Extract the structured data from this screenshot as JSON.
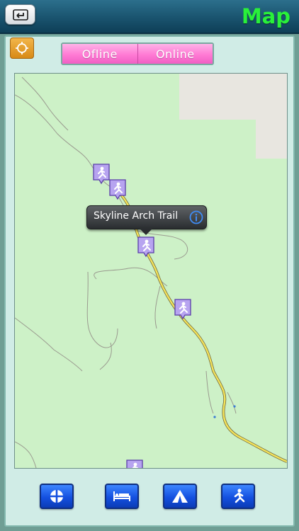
{
  "header": {
    "title": "Map"
  },
  "segments": {
    "offline_label": "Ofline",
    "online_label": "Online"
  },
  "map": {
    "callout": {
      "title": "Skyline Arch Trail"
    },
    "pins": [
      "hiking-trail",
      "hiking-trail",
      "hiking-trail",
      "hiking-trail",
      "hiking-trail"
    ]
  },
  "toolbar": {
    "buttons": [
      "crosshair-icon",
      "bed-icon",
      "tent-icon",
      "hiker-icon"
    ]
  },
  "colors": {
    "title": "#29f03a",
    "segment": "#ff7ad4",
    "locate_button": "#e39a24",
    "toolbar_button": "#1450e0",
    "pin": "#b7a4f0",
    "road": "#f3e35a"
  }
}
